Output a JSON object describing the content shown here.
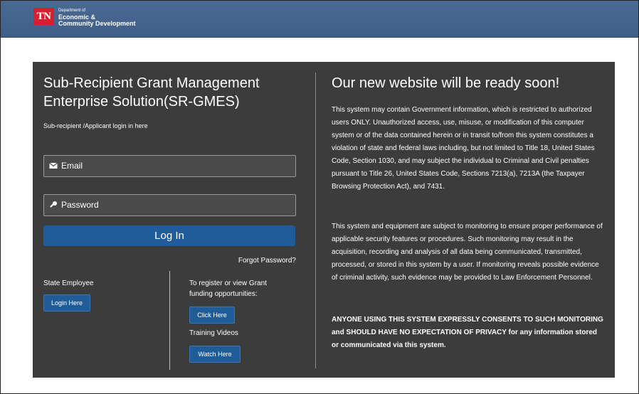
{
  "header": {
    "logo_mark": "TN",
    "logo_small": "Department of",
    "logo_line1": "Economic &",
    "logo_line2": "Community Development"
  },
  "login": {
    "title": "Sub-Recipient Grant Management Enterprise Solution(SR-GMES)",
    "subtitle": "Sub-recipient /Applicant login in here",
    "email_placeholder": "Email",
    "password_placeholder": "Password",
    "login_button": "Log In",
    "forgot_password": "Forgot Password?"
  },
  "state_employee": {
    "label": "State Employee",
    "button": "Login Here"
  },
  "register": {
    "label": "To register or view Grant funding opportunities:",
    "button": "Click Here",
    "training_label": "Training Videos",
    "training_button": "Watch Here"
  },
  "notice": {
    "title": "Our new website will be ready soon!",
    "p1": "This system may contain Government information, which is restricted to authorized users ONLY. Unauthorized access, use, misuse, or modification of this computer system or of the data contained herein or in transit to/from this system constitutes a violation of state and federal laws including, but not limited to Title 18, United States Code, Section 1030, and may subject the individual to Criminal and Civil penalties pursuant to Title 26, United States Code, Sections 7213(a), 7213A (the Taxpayer Browsing Protection Act), and 7431.",
    "p2": "This system and equipment are subject to monitoring to ensure proper performance of applicable security features or procedures. Such monitoring may result in the acquisition, recording and analysis of all data being communicated, transmitted, processed, or stored in this system by a user. If monitoring reveals possible evidence of criminal activity, such evidence may be provided to Law Enforcement Personnel.",
    "p3": "ANYONE USING THIS SYSTEM EXPRESSLY CONSENTS TO SUCH MONITORING and SHOULD HAVE NO EXPECTATION OF PRIVACY for any information stored or communicated via this system."
  },
  "colors": {
    "header_bg": "#4a6a94",
    "panel_bg": "#3c3c3c",
    "button_blue": "#1f5c99",
    "logo_red": "#d6202f"
  }
}
